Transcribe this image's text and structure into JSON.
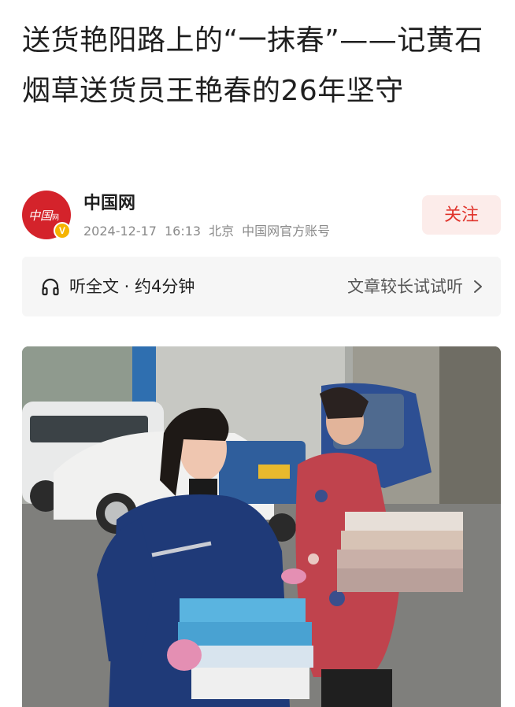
{
  "article": {
    "title": "送货艳阳路上的“一抹春”——记黄石烟草送货员王艳春的26年坚守"
  },
  "author": {
    "name": "中国网",
    "avatar_text": "中国网",
    "verified_mark": "V",
    "date": "2024-12-17",
    "time": "16:13",
    "location": "北京",
    "account_type": "中国网官方账号",
    "follow_label": "关注"
  },
  "listen": {
    "icon": "headphone-icon",
    "label": "听全文 · 约4分钟",
    "hint": "文章较长试试听",
    "chevron": "chevron-right-icon"
  },
  "photo": {
    "description_icon": "article-photo"
  },
  "colors": {
    "accent_red": "#e0332b",
    "follow_bg": "#fcecea",
    "listen_bg": "#f6f6f6",
    "meta_gray": "#8a8a8a",
    "verified_gold": "#f5b400"
  }
}
